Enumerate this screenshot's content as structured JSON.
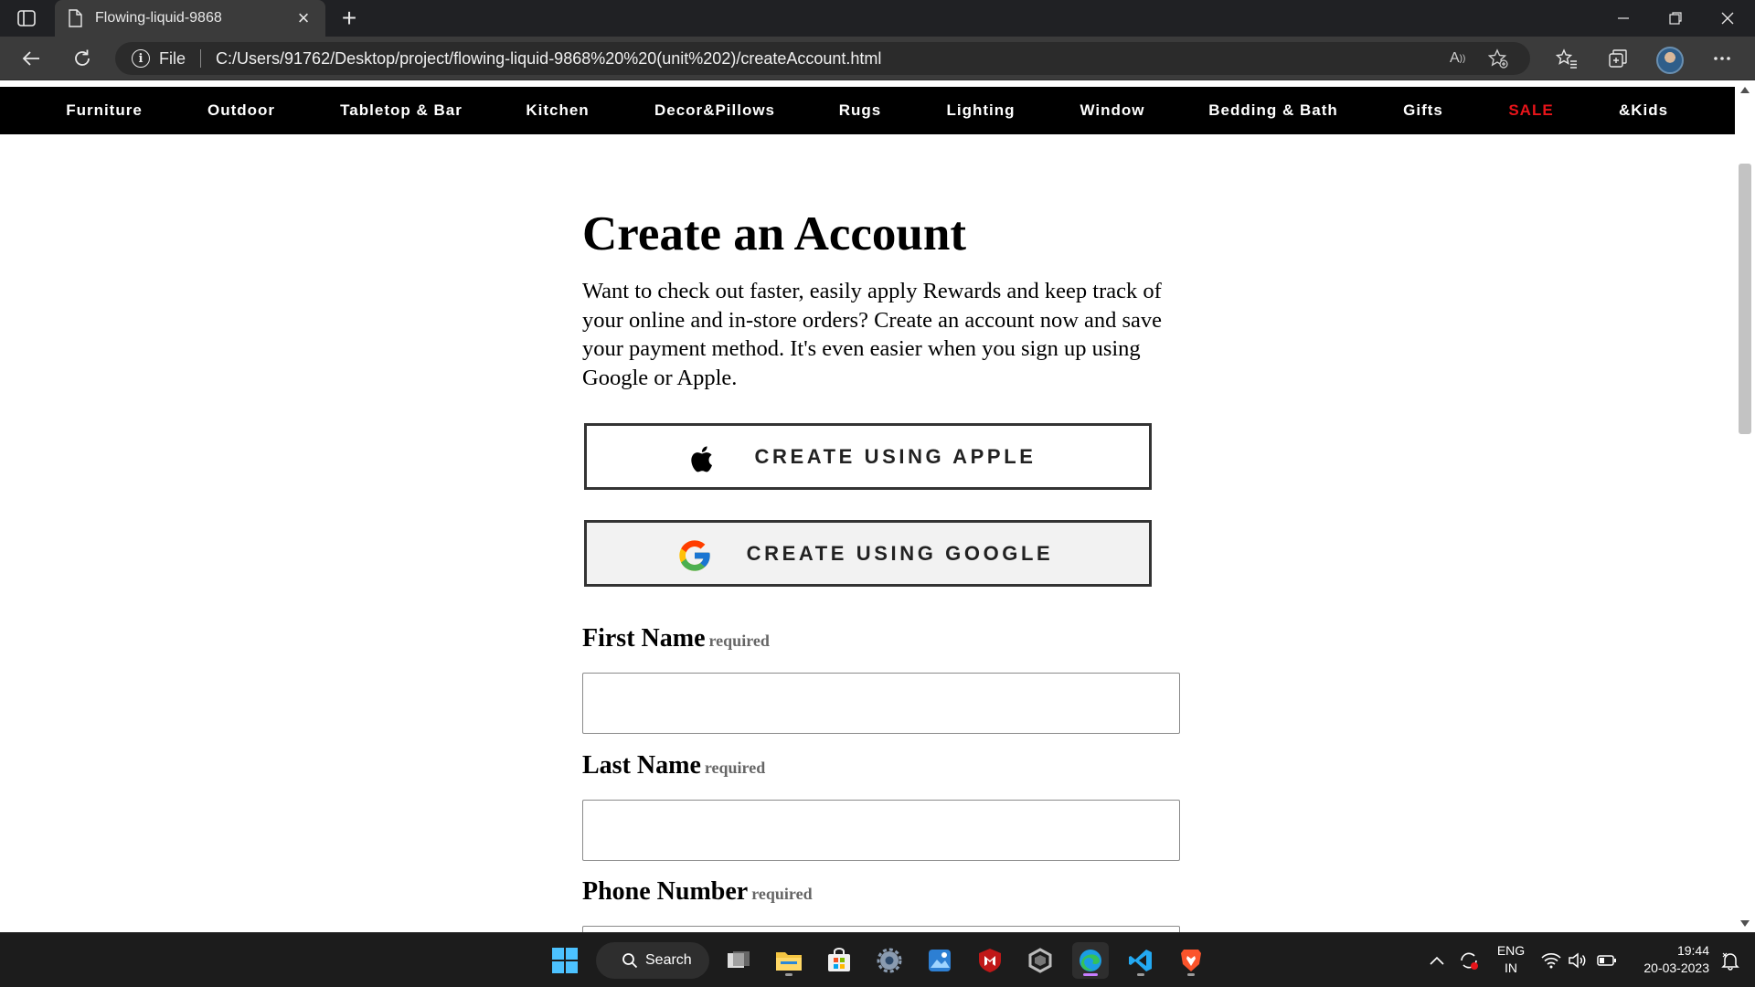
{
  "browser": {
    "tab_title": "Flowing-liquid-9868",
    "address_scheme_label": "File",
    "url": "C:/Users/91762/Desktop/project/flowing-liquid-9868%20%20(unit%202)/createAccount.html"
  },
  "nav": {
    "items": [
      {
        "label": "Furniture"
      },
      {
        "label": "Outdoor"
      },
      {
        "label": "Tabletop & Bar"
      },
      {
        "label": "Kitchen"
      },
      {
        "label": "Decor&Pillows"
      },
      {
        "label": "Rugs"
      },
      {
        "label": "Lighting"
      },
      {
        "label": "Window"
      },
      {
        "label": "Bedding & Bath"
      },
      {
        "label": "Gifts"
      },
      {
        "label": "SALE",
        "color": "#e8141a"
      },
      {
        "label": "&Kids"
      }
    ]
  },
  "page": {
    "title": "Create an Account",
    "intro": "Want to check out faster, easily apply Rewards and keep track of your online and in-store orders? Create an account now and save your payment method. It's even easier when you sign up using Google or Apple.",
    "apple_button": "CREATE USING APPLE",
    "google_button": "CREATE USING GOOGLE",
    "required_text": "required",
    "fields": {
      "first_name": {
        "label": "First Name",
        "value": ""
      },
      "last_name": {
        "label": "Last Name",
        "value": ""
      },
      "phone": {
        "label": "Phone Number",
        "value": ""
      }
    }
  },
  "taskbar": {
    "search_label": "Search",
    "lang_line1": "ENG",
    "lang_line2": "IN",
    "time": "19:44",
    "date": "20-03-2023"
  },
  "colors": {
    "sale": "#e8141a",
    "nav_background": "#000000",
    "browser_chrome": "#3b3b3b"
  },
  "icons": [
    "sidebar-icon",
    "document-icon",
    "close-icon",
    "plus-icon",
    "back-arrow-icon",
    "refresh-icon",
    "info-icon",
    "read-aloud-icon",
    "add-favorite-icon",
    "favorites-icon",
    "collections-icon",
    "more-icon",
    "apple-logo-icon",
    "google-logo-icon",
    "windows-start-icon",
    "search-icon"
  ]
}
